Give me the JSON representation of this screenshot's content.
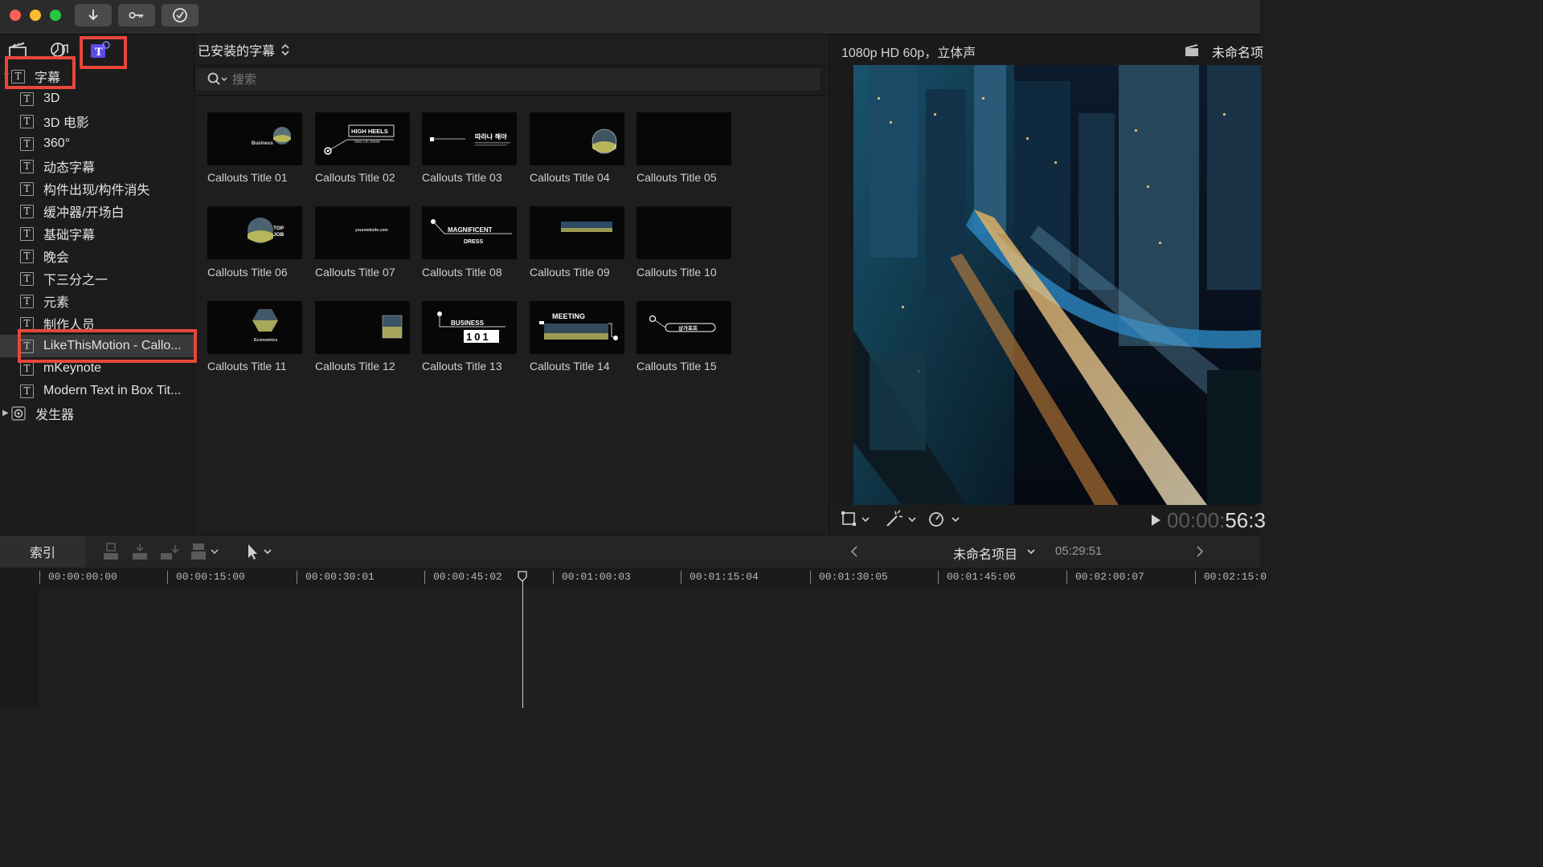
{
  "toolbar": {
    "icons": [
      "import-arrow-icon",
      "key-icon",
      "checkmark-circle-icon"
    ]
  },
  "sidebar": {
    "tool_icons": [
      "clapper-icon",
      "photos-music-icon",
      "titles-generators-icon"
    ],
    "tree": {
      "root_label": "字幕",
      "items": [
        {
          "label": "3D"
        },
        {
          "label": "3D 电影"
        },
        {
          "label": "360°"
        },
        {
          "label": "动态字幕"
        },
        {
          "label": "构件出现/构件消失"
        },
        {
          "label": "缓冲器/开场白"
        },
        {
          "label": "基础字幕"
        },
        {
          "label": "晚会"
        },
        {
          "label": "下三分之一"
        },
        {
          "label": "元素"
        },
        {
          "label": "制作人员"
        },
        {
          "label": "LikeThisMotion - Callo..."
        },
        {
          "label": "mKeynote"
        },
        {
          "label": "Modern Text in Box Tit..."
        }
      ],
      "selected_index": 11,
      "generators_label": "发生器"
    }
  },
  "browser": {
    "title": "已安装的字幕",
    "search": {
      "placeholder": "搜索",
      "value": ""
    },
    "items": [
      {
        "label": "Callouts Title 01",
        "art": "Business"
      },
      {
        "label": "Callouts Title 02",
        "art": "HIGH HEELS",
        "art2": "Toes On Show"
      },
      {
        "label": "Callouts Title 03",
        "art": "따라나 해야"
      },
      {
        "label": "Callouts Title 04",
        "art": ""
      },
      {
        "label": "Callouts Title 05",
        "art": ""
      },
      {
        "label": "Callouts Title 06",
        "art": "TOP",
        "art2": "JOB"
      },
      {
        "label": "Callouts Title 07",
        "art": "yourwebsite.com"
      },
      {
        "label": "Callouts Title 08",
        "art": "MAGNIFICENT",
        "art2": "DRESS"
      },
      {
        "label": "Callouts Title 09",
        "art": ""
      },
      {
        "label": "Callouts Title 10",
        "art": ""
      },
      {
        "label": "Callouts Title 11",
        "art": "Economics"
      },
      {
        "label": "Callouts Title 12",
        "art": ""
      },
      {
        "label": "Callouts Title 13",
        "art": "BUSINESS",
        "art2": "101"
      },
      {
        "label": "Callouts Title 14",
        "art": "MEETING"
      },
      {
        "label": "Callouts Title 15",
        "art": "상가포프"
      }
    ]
  },
  "viewer": {
    "format": "1080p HD 60p，立体声",
    "project": "未命名项",
    "timecode_dim": "00:00:",
    "timecode_bright": "56:3",
    "tools": [
      "transform-icon",
      "magic-wand-icon",
      "speed-gauge-icon"
    ]
  },
  "timeline": {
    "index_label": "索引",
    "project_name": "未命名项目",
    "duration": "05:29:51",
    "ruler": [
      "00:00:00:00",
      "00:00:15:00",
      "00:00:30:01",
      "00:00:45:02",
      "00:01:00:03",
      "00:01:15:04",
      "00:01:30:05",
      "00:01:45:06",
      "00:02:00:07",
      "00:02:15:0"
    ]
  },
  "colors": {
    "highlight": "#e8463a",
    "accent": "#6a5cff",
    "selection": "#3a3a3a"
  }
}
